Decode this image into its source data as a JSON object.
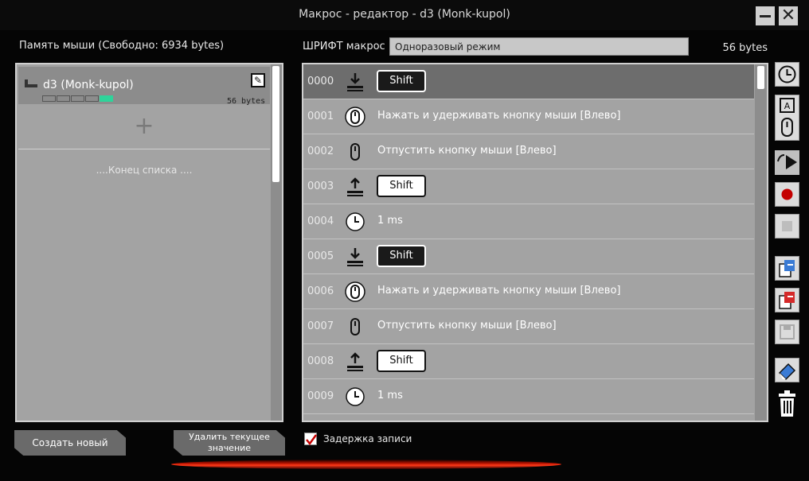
{
  "window": {
    "title": "Макрос - редактор - d3 (Monk-kupol)"
  },
  "left": {
    "memory_label": "Память мыши (Свободно: 6934 bytes)",
    "macro": {
      "name": "d3 (Monk-kupol)",
      "bytes": "56 bytes",
      "memory_used_segments": 1,
      "memory_total_segments": 5
    },
    "add_symbol": "+",
    "end_of_list": "....Конец списка ...."
  },
  "right": {
    "font_label": "ШРИФТ макрос",
    "mode_value": "Одноразовый режим",
    "bytes": "56 bytes",
    "rows": [
      {
        "num": "0000",
        "icon": "key-down-icon",
        "key": "Shift",
        "key_state": "down",
        "selected": true
      },
      {
        "num": "0001",
        "icon": "mouse-press-icon",
        "text": "Нажать и удерживать  кнопку мыши [Влево]"
      },
      {
        "num": "0002",
        "icon": "mouse-release-icon",
        "text": "Отпустить кнопку мыши [Влево]"
      },
      {
        "num": "0003",
        "icon": "key-up-icon",
        "key": "Shift",
        "key_state": "up"
      },
      {
        "num": "0004",
        "icon": "clock-icon",
        "text": "1 ms"
      },
      {
        "num": "0005",
        "icon": "key-down-icon",
        "key": "Shift",
        "key_state": "down"
      },
      {
        "num": "0006",
        "icon": "mouse-press-icon",
        "text": "Нажать и удерживать  кнопку мыши [Влево]"
      },
      {
        "num": "0007",
        "icon": "mouse-release-icon",
        "text": "Отпустить кнопку мыши [Влево]"
      },
      {
        "num": "0008",
        "icon": "key-up-icon",
        "key": "Shift",
        "key_state": "up"
      },
      {
        "num": "0009",
        "icon": "clock-icon",
        "text": "1 ms"
      }
    ]
  },
  "toolbar": [
    "insert-delay-icon",
    "insert-key-mouse-icon",
    "insert-cursor-icon",
    "record-icon",
    "stop-icon",
    "import-icon",
    "export-icon",
    "save-icon",
    "clear-icon",
    "trash-icon"
  ],
  "bottom": {
    "create_label": "Создать новый макрос",
    "delete_label": "Удалить текущее значение",
    "record_delay_label": "Задержка записи",
    "record_delay_checked": true
  },
  "colors": {
    "accent": "#2fd39a",
    "record": "#c40000",
    "glow": "#ff3a1a"
  }
}
